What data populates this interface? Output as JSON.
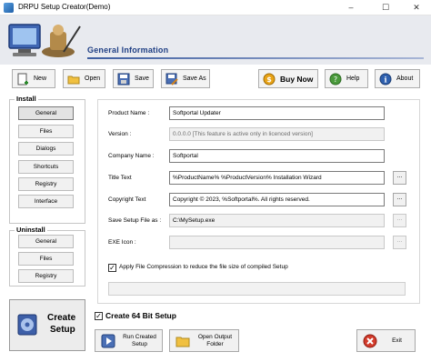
{
  "window": {
    "title": "DRPU Setup Creator(Demo)",
    "minimize": "–",
    "maximize": "☐",
    "close": "✕"
  },
  "header": {
    "section_title": "General Information"
  },
  "toolbar": {
    "new": "New",
    "open": "Open",
    "save": "Save",
    "save_as": "Save As",
    "buy_now": "Buy Now",
    "help": "Help",
    "about": "About"
  },
  "sidebar": {
    "install_title": "Install",
    "install_items": [
      "General",
      "Files",
      "Dialogs",
      "Shortcuts",
      "Registry",
      "Interface"
    ],
    "uninstall_title": "Uninstall",
    "uninstall_items": [
      "General",
      "Files",
      "Registry"
    ]
  },
  "form": {
    "product_name": {
      "label": "Product Name :",
      "value": "Softportal Updater"
    },
    "version": {
      "label": "Version :",
      "value": "0.0.0.0 [This feature is active only in licenced version]"
    },
    "company_name": {
      "label": "Company Name :",
      "value": "Softportal"
    },
    "title_text": {
      "label": "Title Text",
      "value": "%ProductName% %ProductVersion% Installation Wizard"
    },
    "copyright_text": {
      "label": "Copyright Text",
      "value": "Copyright © 2023, %Softportal%. All rights reserved."
    },
    "save_setup_as": {
      "label": "Save Setup File as :",
      "value": "C:\\MySetup.exe"
    },
    "exe_icon": {
      "label": "EXE Icon :",
      "value": ""
    },
    "browse": "...",
    "compression": {
      "label": "Apply File Compression to reduce the file size of compiled Setup",
      "checked": true
    }
  },
  "bottom": {
    "create_64bit": {
      "label": "Create 64 Bit Setup",
      "checked": true
    },
    "create_setup_line1": "Create",
    "create_setup_line2": "Setup",
    "run_line1": "Run Created",
    "run_line2": "Setup",
    "open_folder_line1": "Open Output",
    "open_folder_line2": "Folder",
    "exit": "Exit"
  },
  "colors": {
    "header_bg": "#e8eaef",
    "section_title": "#1f3f84",
    "buy_now_icon": "#e8a317",
    "help_icon": "#4a9a3c",
    "about_icon": "#2d5fae",
    "exit_icon": "#d23b2b"
  }
}
